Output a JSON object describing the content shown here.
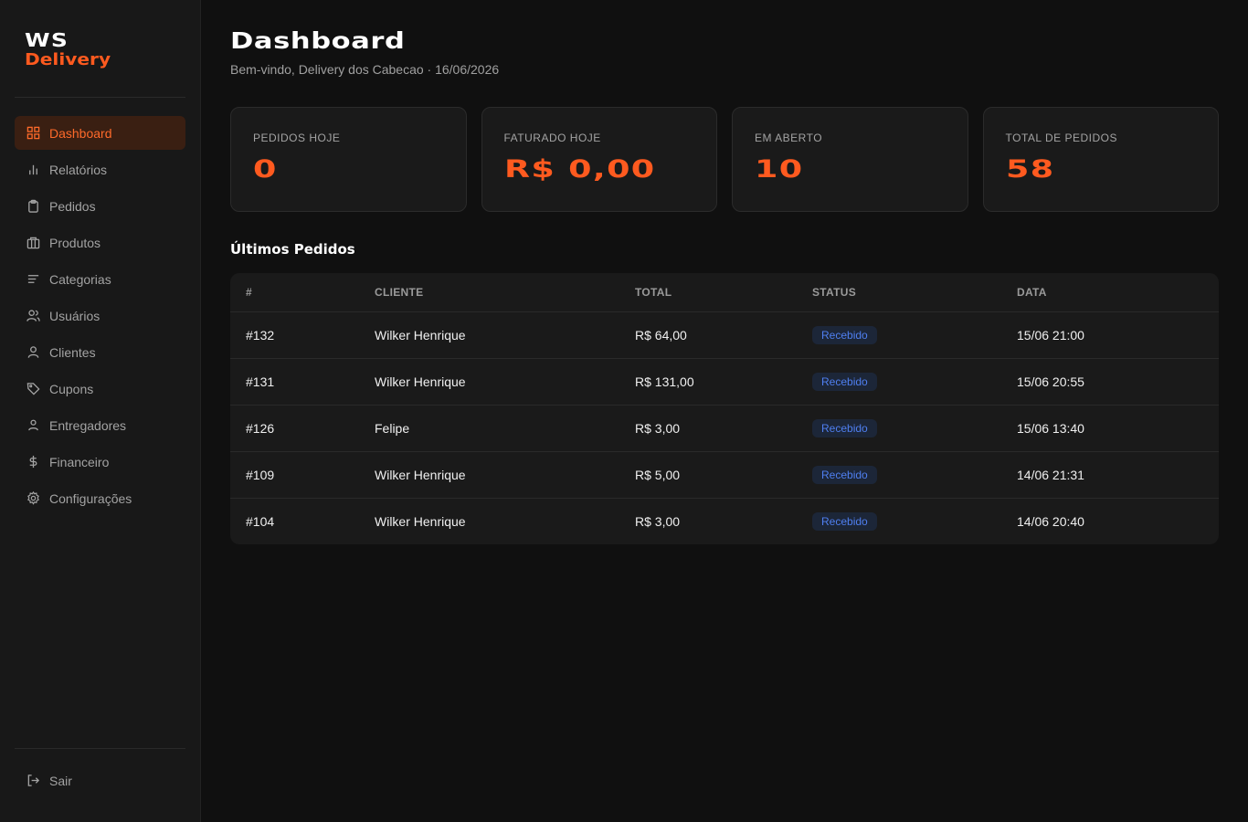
{
  "brand": {
    "line1": "WS",
    "line2": "Delivery"
  },
  "sidebar": {
    "items": [
      {
        "label": "Dashboard",
        "icon": "grid-icon",
        "active": true
      },
      {
        "label": "Relatórios",
        "icon": "bar-chart-icon"
      },
      {
        "label": "Pedidos",
        "icon": "clipboard-icon"
      },
      {
        "label": "Produtos",
        "icon": "package-icon"
      },
      {
        "label": "Categorias",
        "icon": "list-icon"
      },
      {
        "label": "Usuários",
        "icon": "users-icon"
      },
      {
        "label": "Clientes",
        "icon": "user-icon"
      },
      {
        "label": "Cupons",
        "icon": "tag-icon"
      },
      {
        "label": "Entregadores",
        "icon": "user-icon"
      },
      {
        "label": "Financeiro",
        "icon": "dollar-icon"
      },
      {
        "label": "Configurações",
        "icon": "gear-icon"
      }
    ],
    "logout": {
      "label": "Sair",
      "icon": "logout-icon"
    }
  },
  "header": {
    "title": "Dashboard",
    "subtitle": "Bem-vindo, Delivery dos Cabecao · 16/06/2026"
  },
  "stats": [
    {
      "label": "PEDIDOS HOJE",
      "value": "0"
    },
    {
      "label": "FATURADO HOJE",
      "value": "R$ 0,00"
    },
    {
      "label": "EM ABERTO",
      "value": "10"
    },
    {
      "label": "TOTAL DE PEDIDOS",
      "value": "58"
    }
  ],
  "orders": {
    "title": "Últimos Pedidos",
    "columns": [
      "#",
      "CLIENTE",
      "TOTAL",
      "STATUS",
      "DATA"
    ],
    "rows": [
      {
        "id": "#132",
        "client": "Wilker Henrique",
        "total": "R$ 64,00",
        "status": "Recebido",
        "date": "15/06 21:00"
      },
      {
        "id": "#131",
        "client": "Wilker Henrique",
        "total": "R$ 131,00",
        "status": "Recebido",
        "date": "15/06 20:55"
      },
      {
        "id": "#126",
        "client": "Felipe",
        "total": "R$ 3,00",
        "status": "Recebido",
        "date": "15/06 13:40"
      },
      {
        "id": "#109",
        "client": "Wilker Henrique",
        "total": "R$ 5,00",
        "status": "Recebido",
        "date": "14/06 21:31"
      },
      {
        "id": "#104",
        "client": "Wilker Henrique",
        "total": "R$ 3,00",
        "status": "Recebido",
        "date": "14/06 20:40"
      }
    ]
  },
  "colors": {
    "accent": "#ff5a1f",
    "background": "#101010",
    "sidebar": "#181818",
    "card": "#1a1a1a",
    "badge_text": "#4f7ff0",
    "badge_bg": "#1c2638"
  }
}
